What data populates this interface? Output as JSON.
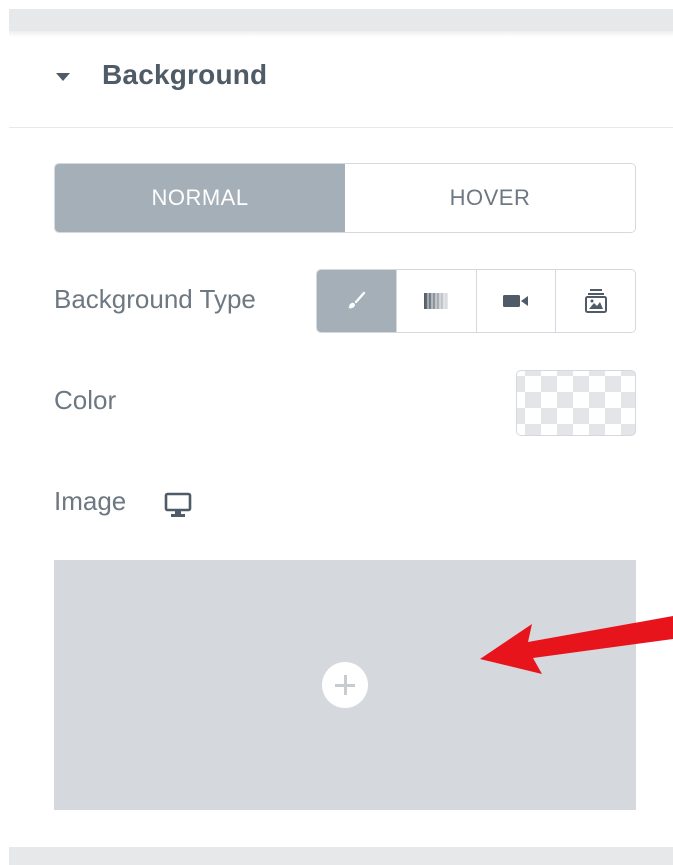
{
  "section": {
    "title": "Background",
    "collapse_icon": "caret-down-icon"
  },
  "state_tabs": [
    {
      "label": "NORMAL",
      "active": true
    },
    {
      "label": "HOVER",
      "active": false
    }
  ],
  "background_type": {
    "label": "Background Type",
    "options": [
      {
        "icon": "paint-brush-icon",
        "active": true
      },
      {
        "icon": "gradient-icon",
        "active": false
      },
      {
        "icon": "video-camera-icon",
        "active": false
      },
      {
        "icon": "slideshow-icon",
        "active": false
      }
    ]
  },
  "color": {
    "label": "Color",
    "value": "transparent"
  },
  "image": {
    "label": "Image",
    "responsive_icon": "desktop-icon",
    "add_icon": "plus-icon"
  },
  "annotation": {
    "icon": "red-arrow-icon",
    "color": "#e8141c"
  },
  "colors": {
    "active_tab": "#a4afb7",
    "text": "#6d7882",
    "heading": "#4f5b66",
    "dropzone": "#d5d8dc"
  }
}
